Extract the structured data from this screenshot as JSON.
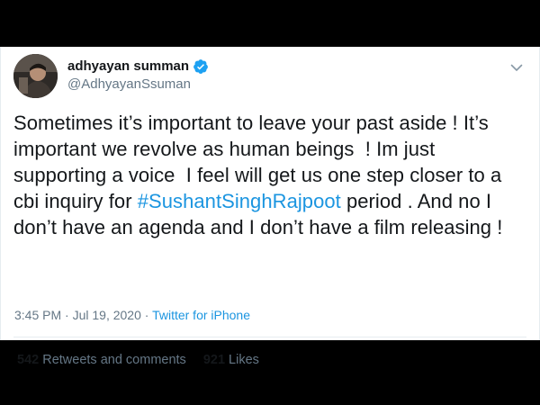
{
  "tweet": {
    "display_name": "adhyayan summan",
    "handle": "@AdhyayanSsuman",
    "text_lines": [
      "Sometimes it’s important to leave your past aside ! It’s",
      "important we revolve as human beings  ! Im just",
      "supporting a voice  I feel will get us one step closer to a",
      "cbi inquiry for ",
      "don’t have an agenda and I don’t have a film releasing !"
    ],
    "hashtag": "#SushantSinghRajpoot",
    "line4_suffix": " period . And no I",
    "timestamp": "3:45 PM · Jul 19, 2020 · ",
    "source": "Twitter for iPhone",
    "retweets_count": "542",
    "retweets_label": " Retweets and comments",
    "likes_count": "921",
    "likes_label": " Likes"
  },
  "icons": {
    "verified": "verified-badge-icon",
    "caret": "chevron-down-icon"
  },
  "colors": {
    "link": "#1b95e0",
    "verified": "#1da1f2",
    "text": "#14171a",
    "muted": "#657786"
  }
}
